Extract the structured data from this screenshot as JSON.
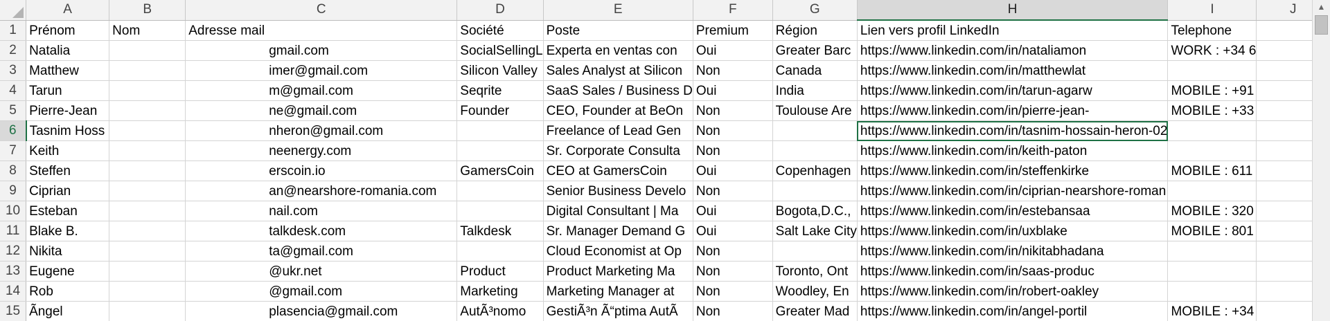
{
  "columns": [
    "A",
    "B",
    "C",
    "D",
    "E",
    "F",
    "G",
    "H",
    "I",
    "J"
  ],
  "selected_column": "H",
  "selected_row": "6",
  "rows": [
    {
      "n": "1",
      "cells": [
        "Prénom",
        "Nom",
        "Adresse mail",
        "Société",
        "Poste",
        "Premium",
        "Région",
        "Lien vers profil LinkedIn",
        "Telephone",
        ""
      ]
    },
    {
      "n": "2",
      "cells": [
        "Natalia",
        "",
        "gmail.com",
        "SocialSellingL",
        "Experta en ventas con",
        "Oui",
        "Greater Barc",
        "https://www.linkedin.com/in/nataliamon",
        "WORK : +34 6",
        ""
      ]
    },
    {
      "n": "3",
      "cells": [
        "Matthew",
        "",
        "imer@gmail.com",
        "Silicon Valley",
        "Sales Analyst at Silicon",
        "Non",
        "Canada",
        "https://www.linkedin.com/in/matthewlat",
        "",
        ""
      ]
    },
    {
      "n": "4",
      "cells": [
        "Tarun",
        "",
        "m@gmail.com",
        "Seqrite",
        "SaaS Sales / Business D",
        "Oui",
        "India",
        "https://www.linkedin.com/in/tarun-agarw",
        "MOBILE : +91",
        ""
      ]
    },
    {
      "n": "5",
      "cells": [
        "Pierre-Jean",
        "",
        "ne@gmail.com",
        "Founder",
        "CEO, Founder at BeOn",
        "Non",
        "Toulouse Are",
        "https://www.linkedin.com/in/pierre-jean-",
        "MOBILE : +33",
        ""
      ]
    },
    {
      "n": "6",
      "cells": [
        "Tasnim Hoss",
        "",
        "nheron@gmail.com",
        "",
        "Freelance of Lead Gen",
        "Non",
        "",
        "https://www.linkedin.com/in/tasnim-hossain-heron-02",
        "",
        ""
      ]
    },
    {
      "n": "7",
      "cells": [
        "Keith",
        "",
        "neenergy.com",
        "",
        "Sr. Corporate Consulta",
        "Non",
        "",
        "https://www.linkedin.com/in/keith-paton",
        "",
        ""
      ]
    },
    {
      "n": "8",
      "cells": [
        "Steffen",
        "",
        "erscoin.io",
        "GamersCoin",
        "CEO at GamersCoin",
        "Oui",
        "Copenhagen",
        "https://www.linkedin.com/in/steffenkirke",
        "MOBILE : 611",
        ""
      ]
    },
    {
      "n": "9",
      "cells": [
        "Ciprian",
        "",
        "an@nearshore-romania.com",
        "",
        "Senior Business Develo",
        "Non",
        "",
        "https://www.linkedin.com/in/ciprian-nearshore-roman",
        "",
        ""
      ]
    },
    {
      "n": "10",
      "cells": [
        "Esteban",
        "",
        "nail.com",
        "",
        "Digital Consultant | Ma",
        "Oui",
        "Bogota,D.C.,",
        "https://www.linkedin.com/in/estebansaa",
        "MOBILE : 320",
        ""
      ]
    },
    {
      "n": "11",
      "cells": [
        "Blake B.",
        "",
        "talkdesk.com",
        "Talkdesk",
        "Sr. Manager Demand G",
        "Oui",
        "Salt Lake City",
        "https://www.linkedin.com/in/uxblake",
        "MOBILE : 801",
        ""
      ]
    },
    {
      "n": "12",
      "cells": [
        "Nikita",
        "",
        "ta@gmail.com",
        "",
        "Cloud Economist at Op",
        "Non",
        "",
        "https://www.linkedin.com/in/nikitabhadana",
        "",
        ""
      ]
    },
    {
      "n": "13",
      "cells": [
        "Eugene",
        "",
        "@ukr.net",
        "Product",
        "Product Marketing Ma",
        "Non",
        "Toronto, Ont",
        "https://www.linkedin.com/in/saas-produc",
        "",
        ""
      ]
    },
    {
      "n": "14",
      "cells": [
        "Rob",
        "",
        "@gmail.com",
        "Marketing",
        "Marketing Manager at",
        "Non",
        "Woodley, En",
        "https://www.linkedin.com/in/robert-oakley",
        "",
        ""
      ]
    },
    {
      "n": "15",
      "cells": [
        "Ãngel",
        "",
        "plasencia@gmail.com",
        "AutÃ³nomo",
        "GestiÃ³n Ã“ptima AutÃ",
        "Non",
        "Greater Mad",
        "https://www.linkedin.com/in/angel-portil",
        "MOBILE : +34",
        ""
      ]
    }
  ],
  "scrollbar": {
    "up_glyph": "▲"
  }
}
